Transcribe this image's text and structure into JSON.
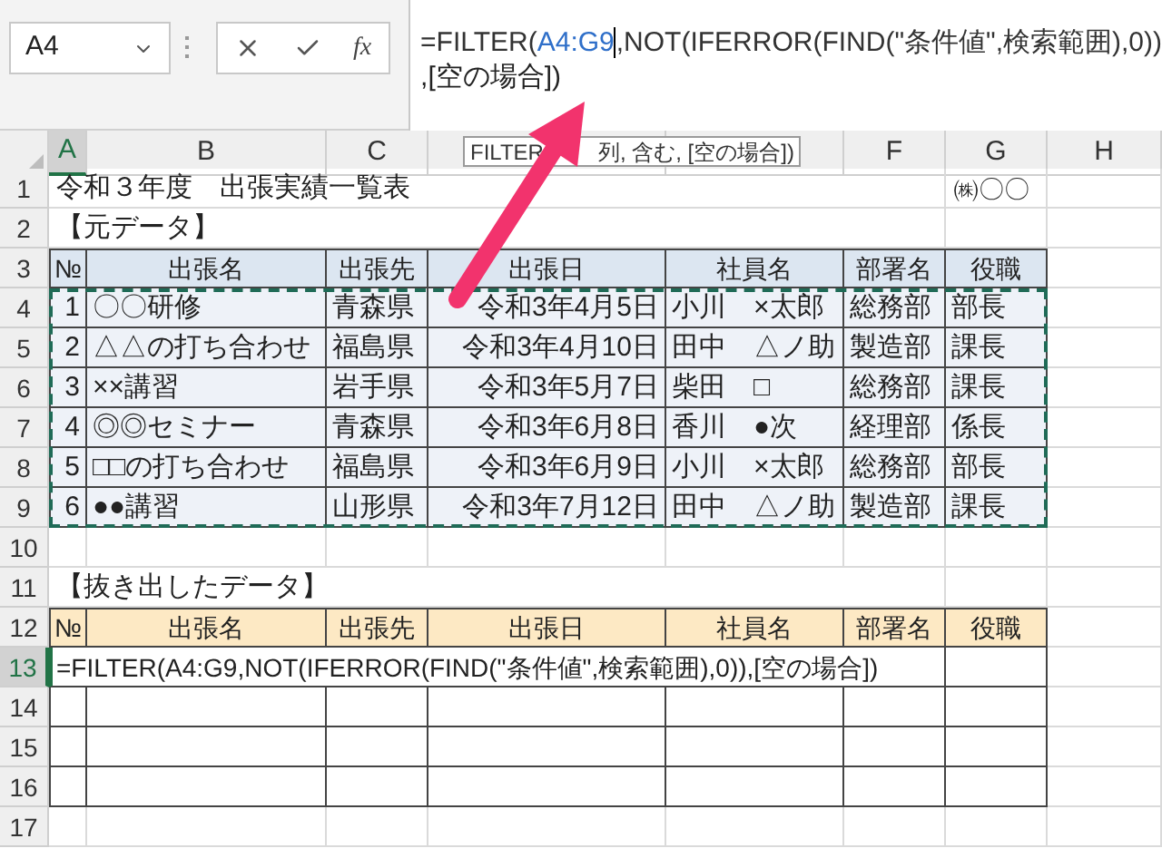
{
  "name_box": {
    "value": "A4"
  },
  "formula_buttons": {
    "function_label": "fx"
  },
  "formula_bar": {
    "parts": [
      {
        "text": "=FILTER(",
        "kind": "plain",
        "caret": false
      },
      {
        "text": "A4:G9",
        "kind": "ref",
        "caret": true
      },
      {
        "text": ",NOT(IFERROR(FIND(\"条件値\",検索範囲),0))",
        "kind": "plain",
        "caret": false
      }
    ],
    "line2": ",[空の場合])"
  },
  "tooltip": {
    "parts": [
      "FILTER",
      "列, 含む, [空の場合])"
    ]
  },
  "columns": [
    {
      "label": "A",
      "selected": true
    },
    {
      "label": "B",
      "selected": false
    },
    {
      "label": "C",
      "selected": false
    },
    {
      "selected": false
    },
    {
      "selected": false
    },
    {
      "label": "F",
      "selected": false
    },
    {
      "label": "G",
      "selected": false
    },
    {
      "label": "H",
      "selected": false
    }
  ],
  "rows": [
    {
      "number": "1",
      "selected": false,
      "kind": "note",
      "text": "令和３年度　出張実績一覧表",
      "right_text": "㈱〇〇"
    },
    {
      "number": "2",
      "selected": false,
      "kind": "note",
      "text": "【元データ】"
    },
    {
      "number": "3",
      "selected": false,
      "kind": "header",
      "color": "#dce6f1",
      "cells": [
        "№",
        "出張名",
        "出張先",
        "出張日",
        "社員名",
        "部署名",
        "役職"
      ]
    },
    {
      "number": "4",
      "selected": false,
      "kind": "data",
      "cells": [
        "1",
        "〇〇研修",
        "青森県",
        "令和3年4月5日",
        "小川　×太郎",
        "総務部",
        "部長"
      ]
    },
    {
      "number": "5",
      "selected": false,
      "kind": "data",
      "cells": [
        "2",
        "△△の打ち合わせ",
        "福島県",
        "令和3年4月10日",
        "田中　△ノ助",
        "製造部",
        "課長"
      ]
    },
    {
      "number": "6",
      "selected": false,
      "kind": "data",
      "cells": [
        "3",
        "××講習",
        "岩手県",
        "令和3年5月7日",
        "柴田　□",
        "総務部",
        "課長"
      ]
    },
    {
      "number": "7",
      "selected": false,
      "kind": "data",
      "cells": [
        "4",
        "◎◎セミナー",
        "青森県",
        "令和3年6月8日",
        "香川　●次",
        "経理部",
        "係長"
      ]
    },
    {
      "number": "8",
      "selected": false,
      "kind": "data",
      "cells": [
        "5",
        "□□の打ち合わせ",
        "福島県",
        "令和3年6月9日",
        "小川　×太郎",
        "総務部",
        "部長"
      ]
    },
    {
      "number": "9",
      "selected": false,
      "kind": "data",
      "cells": [
        "6",
        "●●講習",
        "山形県",
        "令和3年7月12日",
        "田中　△ノ助",
        "製造部",
        "課長"
      ]
    },
    {
      "number": "10",
      "selected": false,
      "kind": "blank"
    },
    {
      "number": "11",
      "selected": false,
      "kind": "note",
      "text": "【抜き出したデータ】"
    },
    {
      "number": "12",
      "selected": false,
      "kind": "header",
      "color": "#fde9c4",
      "cells": [
        "№",
        "出張名",
        "出張先",
        "出張日",
        "社員名",
        "部署名",
        "役職"
      ]
    },
    {
      "number": "13",
      "selected": true,
      "kind": "formula",
      "text": "=FILTER(A4:G9,NOT(IFERROR(FIND(\"条件値\",検索範囲),0)),[空の場合])"
    },
    {
      "number": "14",
      "selected": false,
      "kind": "table_blank"
    },
    {
      "number": "15",
      "selected": false,
      "kind": "table_blank"
    },
    {
      "number": "16",
      "selected": false,
      "kind": "table_blank"
    },
    {
      "number": "17",
      "selected": false,
      "kind": "blank"
    }
  ]
}
